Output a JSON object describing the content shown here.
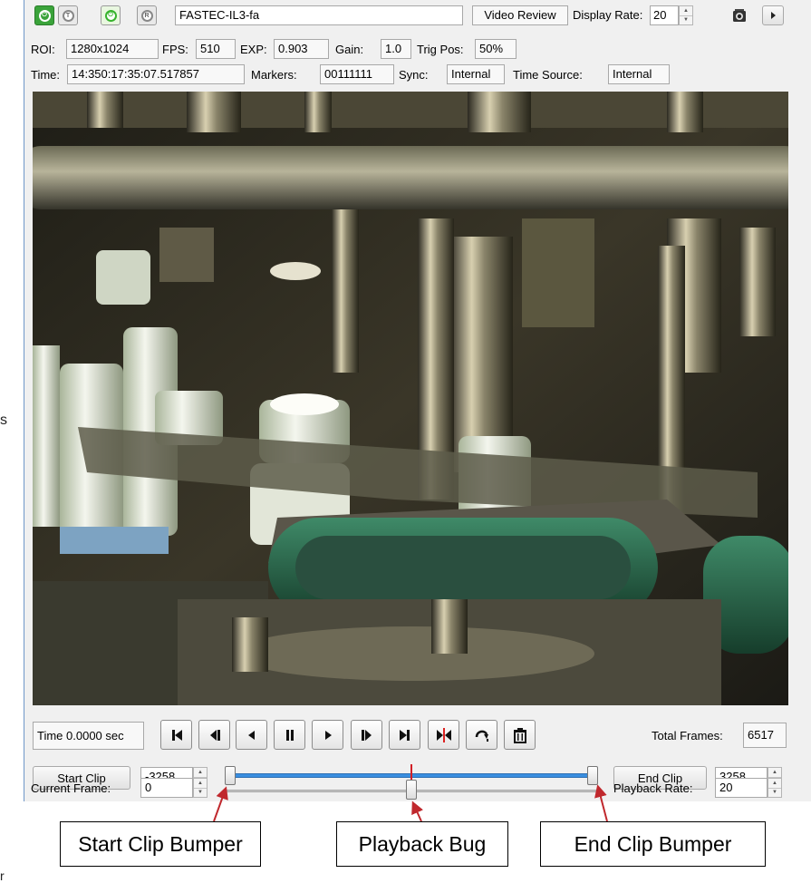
{
  "edge_text": {
    "left_fragment": "s",
    "bottom_fragment": "r"
  },
  "header": {
    "record_buttons": [
      {
        "name": "record-on-icon",
        "glyph": "⏻"
      },
      {
        "name": "trigger-icon",
        "glyph": "T"
      },
      {
        "name": "live-icon",
        "glyph": "⏻"
      },
      {
        "name": "review-icon",
        "glyph": "R"
      }
    ],
    "camera_name": "FASTEC-IL3-fa",
    "mode": "Video Review",
    "display_rate_label": "Display Rate:",
    "display_rate_value": "20",
    "snapshot_icon": "camera-icon",
    "expand_icon": "arrow-right-icon"
  },
  "info_row1": {
    "roi_label": "ROI:",
    "roi_value": "1280x1024",
    "fps_label": "FPS:",
    "fps_value": "510",
    "exp_label": "EXP:",
    "exp_value": "0.903",
    "gain_label": "Gain:",
    "gain_value": "1.0",
    "trig_label": "Trig Pos:",
    "trig_value": "50%"
  },
  "info_row2": {
    "time_label": "Time:",
    "time_value": "14:350:17:35:07.517857",
    "markers_label": "Markers:",
    "markers_value": "00111111",
    "sync_label": "Sync:",
    "sync_value": "Internal",
    "time_source_label": "Time Source:",
    "time_source_value": "Internal"
  },
  "transport": {
    "time_display": "Time 0.0000 sec",
    "buttons": [
      "go-to-start-icon",
      "step-back-icon",
      "play-reverse-icon",
      "pause-icon",
      "play-icon",
      "step-forward-icon",
      "go-to-end-icon",
      "go-to-trigger-icon",
      "loop-icon",
      "delete-icon"
    ],
    "total_frames_label": "Total Frames:",
    "total_frames_value": "6517"
  },
  "clip": {
    "start_clip_label": "Start Clip",
    "start_clip_value": "-3258",
    "end_clip_label": "End Clip",
    "end_clip_value": "3258",
    "bumper_start_fraction": 0.0,
    "bumper_end_fraction": 1.0,
    "trigger_marker_fraction": 0.5
  },
  "playback": {
    "current_frame_label": "Current Frame:",
    "current_frame_value": "0",
    "playback_rate_label": "Playback Rate:",
    "playback_rate_value": "20",
    "playback_position_fraction": 0.5
  },
  "callouts": {
    "start_bumper": "Start Clip Bumper",
    "playback_bug": "Playback Bug",
    "end_bumper": "End Clip Bumper"
  },
  "colors": {
    "slider_blue": "#3a8ee0",
    "arrow_red": "#c0282d",
    "record_green": "#3aa33a"
  }
}
